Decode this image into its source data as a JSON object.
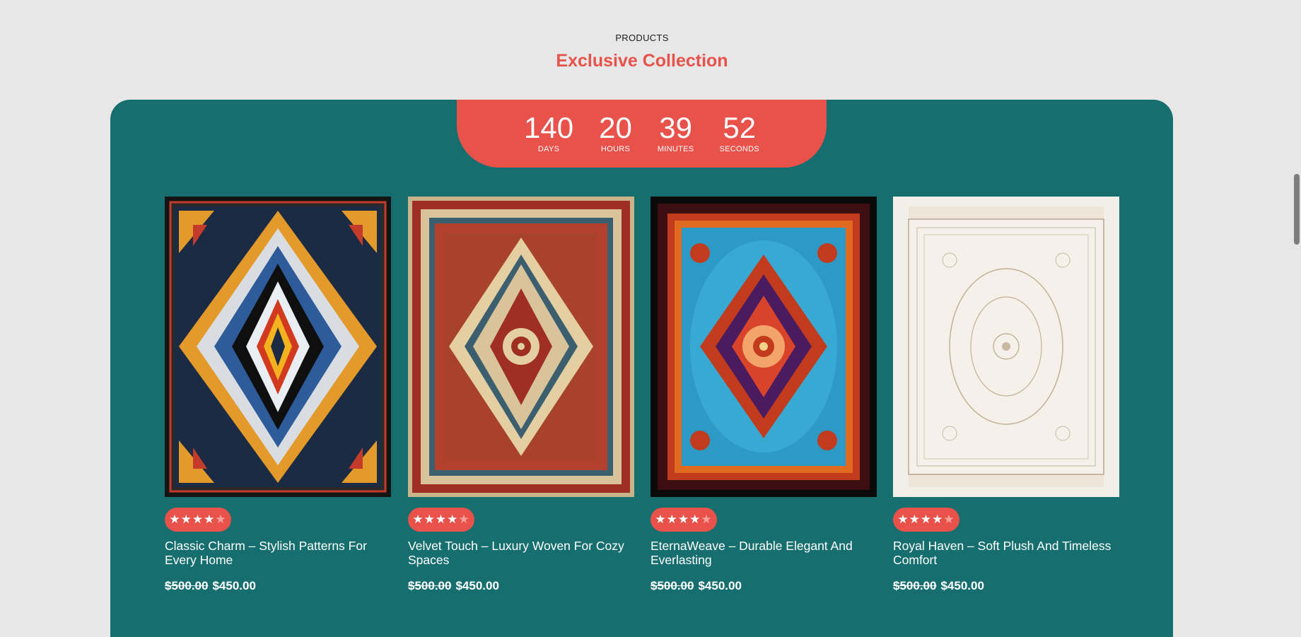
{
  "section": {
    "eyebrow": "PRODUCTS",
    "heading": "Exclusive Collection"
  },
  "countdown": [
    {
      "value": "140",
      "label": "DAYS"
    },
    {
      "value": "20",
      "label": "HOURS"
    },
    {
      "value": "39",
      "label": "MINUTES"
    },
    {
      "value": "52",
      "label": "SECONDS"
    }
  ],
  "products": [
    {
      "title": "Classic Charm – Stylish Patterns For Every Home",
      "old_price": "$500.00",
      "price": "$450.00",
      "rating_stars": 4,
      "rating_max": 5
    },
    {
      "title": "Velvet Touch – Luxury Woven For Cozy Spaces",
      "old_price": "$500.00",
      "price": "$450.00",
      "rating_stars": 4,
      "rating_max": 5
    },
    {
      "title": "EternaWeave – Durable Elegant And Everlasting",
      "old_price": "$500.00",
      "price": "$450.00",
      "rating_stars": 4,
      "rating_max": 5
    },
    {
      "title": "Royal Haven – Soft Plush And Timeless Comfort",
      "old_price": "$500.00",
      "price": "$450.00",
      "rating_stars": 4,
      "rating_max": 5
    }
  ],
  "colors": {
    "accent": "#e8524a",
    "panel": "#176e6f",
    "background": "#e7e7e7"
  }
}
